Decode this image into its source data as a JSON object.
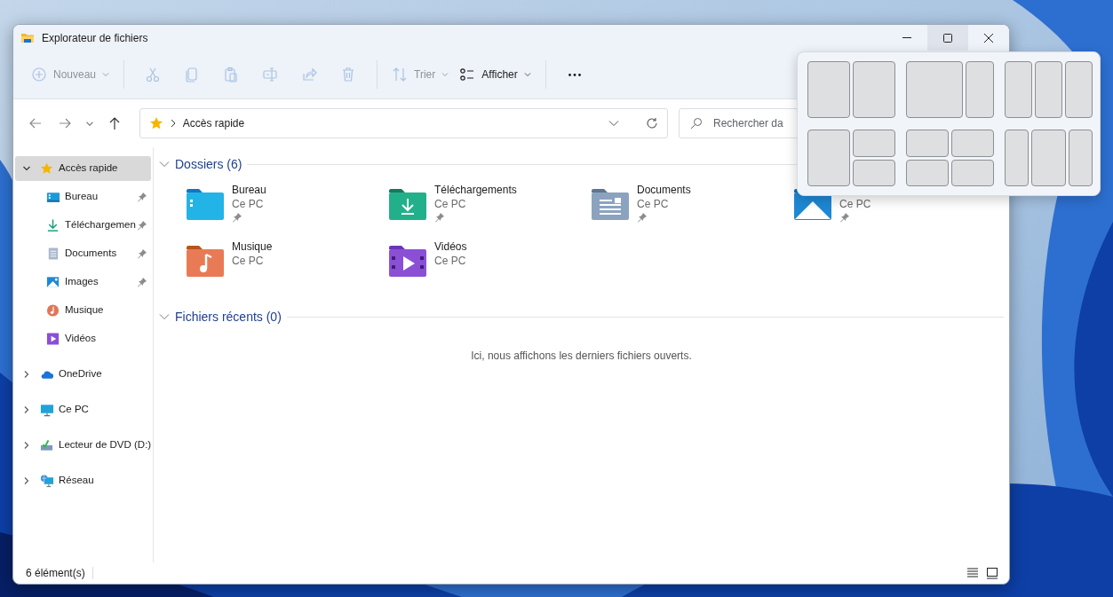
{
  "window": {
    "title": "Explorateur de fichiers"
  },
  "toolbar": [
    {
      "kind": "new",
      "label": "Nouveau",
      "disabled": true
    },
    {
      "kind": "separator"
    },
    {
      "kind": "cut",
      "disabled": true
    },
    {
      "kind": "copy",
      "disabled": true
    },
    {
      "kind": "paste",
      "disabled": true
    },
    {
      "kind": "rename",
      "disabled": true
    },
    {
      "kind": "share",
      "disabled": true
    },
    {
      "kind": "delete",
      "disabled": true
    },
    {
      "kind": "separator"
    },
    {
      "kind": "sort",
      "label": "Trier",
      "disabled": true
    },
    {
      "kind": "view",
      "label": "Afficher",
      "disabled": false
    },
    {
      "kind": "separator"
    },
    {
      "kind": "more",
      "disabled": false
    }
  ],
  "address": {
    "path": "Accès rapide"
  },
  "search": {
    "placeholder": "Rechercher da"
  },
  "sidebar": {
    "items": [
      {
        "label": "Accès rapide",
        "kind": "star",
        "expanded": true,
        "selected": true,
        "children": [
          {
            "label": "Bureau",
            "kind": "desktop",
            "pinned": true,
            "selected": false
          },
          {
            "label": "Téléchargemen",
            "kind": "download",
            "pinned": true,
            "selected": false
          },
          {
            "label": "Documents",
            "kind": "documents",
            "pinned": true,
            "selected": false
          },
          {
            "label": "Images",
            "kind": "images",
            "pinned": true,
            "selected": false
          },
          {
            "label": "Musique",
            "kind": "music",
            "pinned": false,
            "selected": false
          },
          {
            "label": "Vidéos",
            "kind": "videos",
            "pinned": false,
            "selected": false
          }
        ]
      },
      {
        "label": "OneDrive",
        "kind": "cloud",
        "expanded": false,
        "selected": false
      },
      {
        "label": "Ce PC",
        "kind": "computer",
        "expanded": false,
        "selected": false
      },
      {
        "label": "Lecteur de DVD (D:)",
        "kind": "dvd",
        "expanded": false,
        "selected": false
      },
      {
        "label": "Réseau",
        "kind": "network",
        "expanded": false,
        "selected": false
      }
    ]
  },
  "sections": [
    {
      "title": "Dossiers (6)",
      "expanded": true,
      "folders": [
        {
          "name": "Bureau",
          "location": "Ce PC",
          "pinned": true,
          "kind": "desktop"
        },
        {
          "name": "Téléchargements",
          "location": "Ce PC",
          "pinned": true,
          "kind": "download"
        },
        {
          "name": "Documents",
          "location": "Ce PC",
          "pinned": true,
          "kind": "documents"
        },
        {
          "location": "Ce PC",
          "pinned": true,
          "kind": "images"
        },
        {
          "name": "Musique",
          "location": "Ce PC",
          "pinned": false,
          "kind": "music"
        },
        {
          "name": "Vidéos",
          "location": "Ce PC",
          "pinned": false,
          "kind": "videos"
        }
      ]
    },
    {
      "title": "Fichiers récents (0)",
      "expanded": true,
      "empty_message": "Ici, nous affichons les derniers fichiers ouverts."
    }
  ],
  "status_bar": {
    "count": "6 élément(s)"
  }
}
